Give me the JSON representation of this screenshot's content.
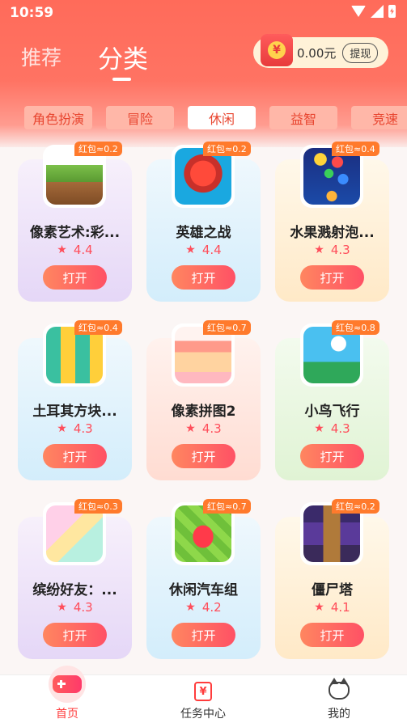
{
  "status_bar": {
    "time": "10:59"
  },
  "header": {
    "tabs": [
      {
        "label": "推荐"
      },
      {
        "label": "分类"
      }
    ],
    "wallet": {
      "currency_symbol": "¥",
      "amount": "0.00元",
      "withdraw_label": "提现"
    }
  },
  "categories": [
    {
      "label": "角色扮演"
    },
    {
      "label": "冒险"
    },
    {
      "label": "休闲"
    },
    {
      "label": "益智"
    },
    {
      "label": "竞速"
    }
  ],
  "active_category": "休闲",
  "games": [
    {
      "name": "像素艺术:彩...",
      "rating": "4.4",
      "badge": "红包≈0.2",
      "button": "打开",
      "icon": "pixel-island-icon"
    },
    {
      "name": "英雄之战",
      "rating": "4.4",
      "badge": "红包≈0.2",
      "button": "打开",
      "icon": "red-robot-icon"
    },
    {
      "name": "水果溅射泡...",
      "rating": "4.3",
      "badge": "红包≈0.4",
      "button": "打开",
      "icon": "bubble-shooter-icon"
    },
    {
      "name": "土耳其方块...",
      "rating": "4.3",
      "badge": "红包≈0.4",
      "button": "打开",
      "icon": "block-puzzle-icon"
    },
    {
      "name": "像素拼图2",
      "rating": "4.3",
      "badge": "红包≈0.7",
      "button": "打开",
      "icon": "pixel-house-icon"
    },
    {
      "name": "小鸟飞行",
      "rating": "4.3",
      "badge": "红包≈0.8",
      "button": "打开",
      "icon": "flying-pig-icon"
    },
    {
      "name": "缤纷好友：...",
      "rating": "4.3",
      "badge": "红包≈0.3",
      "button": "打开",
      "icon": "anime-friends-icon"
    },
    {
      "name": "休闲汽车组",
      "rating": "4.2",
      "badge": "红包≈0.7",
      "button": "打开",
      "icon": "race-car-icon"
    },
    {
      "name": "僵尸塔",
      "rating": "4.1",
      "badge": "红包≈0.2",
      "button": "打开",
      "icon": "zombie-tower-icon"
    }
  ],
  "bottom_nav": [
    {
      "label": "首页"
    },
    {
      "label": "任务中心",
      "icon_glyph": "¥"
    },
    {
      "label": "我的"
    }
  ],
  "colors": {
    "primary": "#ff6b5a",
    "accent": "#ff5165",
    "badge": "#ff7a2c"
  }
}
